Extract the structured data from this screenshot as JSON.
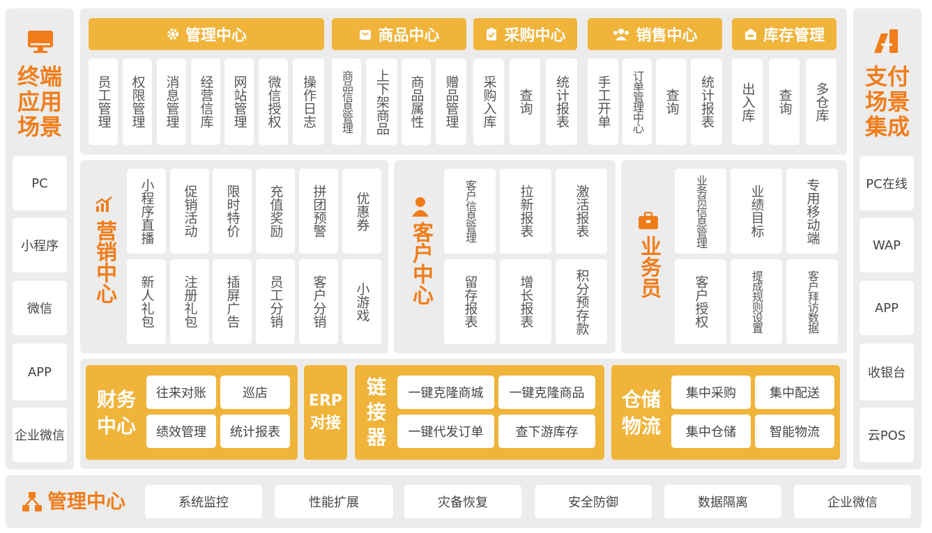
{
  "left_panel": {
    "title": "终端\n应用\n场景",
    "items": [
      "PC",
      "小程序",
      "微信",
      "APP",
      "企业微信"
    ]
  },
  "right_panel": {
    "title": "支付\n场景\n集成",
    "items": [
      "PC在线",
      "WAP",
      "APP",
      "收银台",
      "云POS"
    ]
  },
  "top_modules": [
    {
      "title": "管理中心",
      "icon": "gear-icon",
      "items": [
        "员工管理",
        "权限管理",
        "消息管理",
        "经营信库",
        "网站管理",
        "微信授权",
        "操作日志"
      ]
    },
    {
      "title": "商品中心",
      "icon": "bag-icon",
      "items": [
        "商品信息管理",
        "上下架商品",
        "商品属性",
        "赠品管理"
      ]
    },
    {
      "title": "采购中心",
      "icon": "clipboard-icon",
      "items": [
        "采购入库",
        "查询",
        "统计报表"
      ]
    },
    {
      "title": "销售中心",
      "icon": "users-icon",
      "items": [
        "手工开单",
        "订单管理中心",
        "查询",
        "统计报表"
      ]
    },
    {
      "title": "库存管理",
      "icon": "warehouse-icon",
      "items": [
        "出入库",
        "查询",
        "多仓库"
      ]
    }
  ],
  "middle_sections": [
    {
      "title": "营销中心",
      "icon": "chart-icon",
      "row1": [
        "小程序直播",
        "促销活动",
        "限时特价",
        "充值奖励",
        "拼团预警",
        "优惠券"
      ],
      "row2": [
        "新人礼包",
        "注册礼包",
        "插屏广告",
        "员工分销",
        "客户分销",
        "小游戏"
      ]
    },
    {
      "title": "客户中心",
      "icon": "person-icon",
      "row1": [
        "客户信息管理",
        "拉新报表",
        "激活报表"
      ],
      "row2": [
        "留存报表",
        "增长报表",
        "积分预存款"
      ]
    },
    {
      "title": "业务员",
      "icon": "briefcase-icon",
      "row1": [
        "业务员信息管理",
        "业绩目标",
        "专用移动端"
      ],
      "row2": [
        "客户授权",
        "提成规则设置",
        "客户拜访数据"
      ]
    }
  ],
  "bottom_modules": {
    "finance": {
      "title": "财务\n中心",
      "items": [
        "往来对账",
        "巡店",
        "绩效管理",
        "统计报表"
      ]
    },
    "erp": {
      "title": "ERP\n对接"
    },
    "linker": {
      "title": "链\n接\n器",
      "items": [
        "一键克隆商城",
        "一键克隆商品",
        "一键代发订单",
        "查下游库存"
      ]
    },
    "warehouse": {
      "title": "仓储\n物流",
      "items": [
        "集中采购",
        "集中配送",
        "集中仓储",
        "智能物流"
      ]
    }
  },
  "footer": {
    "title": "管理中心",
    "icon": "network-icon",
    "items": [
      "系统监控",
      "性能扩展",
      "灾备恢复",
      "安全防御",
      "数据隔离",
      "企业微信"
    ]
  },
  "colors": {
    "accent": "#f0b43a",
    "title": "#f07d1a",
    "panel": "#ececec"
  }
}
